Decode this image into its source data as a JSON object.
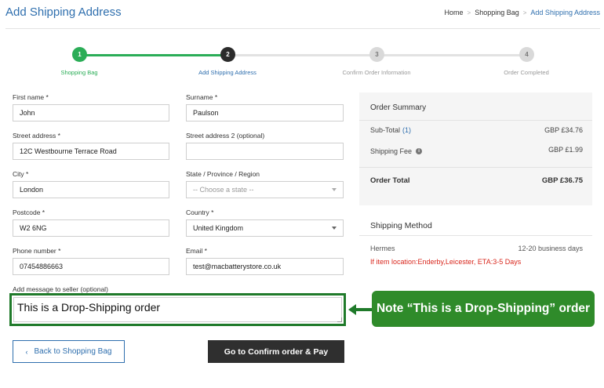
{
  "header": {
    "title": "Add Shipping Address",
    "breadcrumb": [
      "Home",
      "Shopping Bag",
      "Add Shipping Address"
    ],
    "breadcrumb_separator": ">"
  },
  "stepper": {
    "steps": [
      {
        "number": "1",
        "label": "Shopping Bag",
        "state": "done"
      },
      {
        "number": "2",
        "label": "Add Shipping Address",
        "state": "current"
      },
      {
        "number": "3",
        "label": "Confirm Order Information",
        "state": "todo"
      },
      {
        "number": "4",
        "label": "Order Completed",
        "state": "todo"
      }
    ]
  },
  "form": {
    "first_name": {
      "label": "First name *",
      "value": "John"
    },
    "surname": {
      "label": "Surname *",
      "value": "Paulson"
    },
    "street_address": {
      "label": "Street address *",
      "value": "12C Westbourne Terrace Road"
    },
    "street_address_2": {
      "label": "Street address 2 (optional)",
      "value": ""
    },
    "city": {
      "label": "City *",
      "value": "London"
    },
    "state": {
      "label": "State / Province / Region",
      "value": "-- Choose a state --"
    },
    "postcode": {
      "label": "Postcode *",
      "value": "W2 6NG"
    },
    "country": {
      "label": "Country *",
      "value": "United Kingdom"
    },
    "phone": {
      "label": "Phone number *",
      "value": "07454886663"
    },
    "email": {
      "label": "Email *",
      "value": "test@macbatterystore.co.uk"
    },
    "message": {
      "label": "Add message to seller (optional)",
      "value": "This is a Drop-Shipping order"
    }
  },
  "buttons": {
    "back": "Back to Shopping Bag",
    "back_icon": "chevron-left-icon",
    "confirm": "Go to Confirm order & Pay"
  },
  "annotation": {
    "text": "Note “This is a Drop-Shipping” order",
    "color": "#2f8b2a"
  },
  "order_summary": {
    "title": "Order Summary",
    "subtotal_label": "Sub-Total",
    "subtotal_count": "(1)",
    "subtotal_value": "GBP £34.76",
    "shipping_label": "Shipping Fee",
    "shipping_value": "GBP £1.99",
    "total_label": "Order Total",
    "total_value": "GBP £36.75"
  },
  "shipping_method": {
    "title": "Shipping Method",
    "carrier": "Hermes",
    "days": "12-20 business days",
    "note": "If item location:Enderby,Leicester, ETA:3-5 Days"
  },
  "colors": {
    "accent_blue": "#2f6fae",
    "step_done_green": "#2bad57",
    "note_red": "#d9271d",
    "confirm_button": "#2f2f2f"
  }
}
